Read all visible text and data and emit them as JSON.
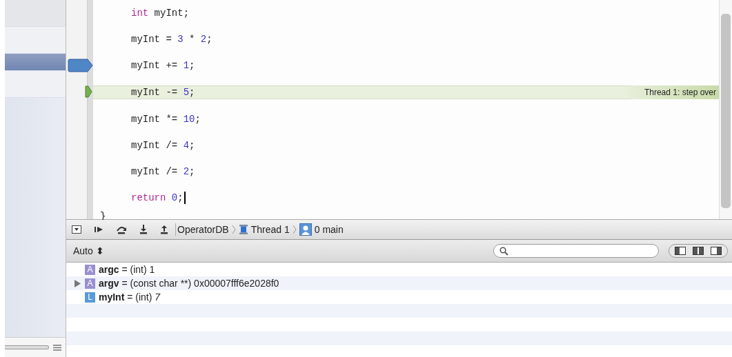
{
  "sidebar": {
    "rows": [
      {
        "selected": false
      },
      {
        "selected": false
      },
      {
        "selected": true
      },
      {
        "selected": false
      }
    ]
  },
  "code": {
    "lines": [
      {
        "tokens": [
          {
            "text": "int",
            "kind": "keyword"
          },
          {
            "text": " myInt;",
            "kind": "plain"
          }
        ],
        "breakpoint": false,
        "current": false
      },
      {
        "tokens": [
          {
            "text": "myInt = ",
            "kind": "plain"
          },
          {
            "text": "3",
            "kind": "number"
          },
          {
            "text": " * ",
            "kind": "plain"
          },
          {
            "text": "2",
            "kind": "number"
          },
          {
            "text": ";",
            "kind": "plain"
          }
        ],
        "breakpoint": false,
        "current": false
      },
      {
        "tokens": [
          {
            "text": "myInt += ",
            "kind": "plain"
          },
          {
            "text": "1",
            "kind": "number"
          },
          {
            "text": ";",
            "kind": "plain"
          }
        ],
        "breakpoint": true,
        "current": false
      },
      {
        "tokens": [
          {
            "text": "myInt -= ",
            "kind": "plain"
          },
          {
            "text": "5",
            "kind": "number"
          },
          {
            "text": ";",
            "kind": "plain"
          }
        ],
        "breakpoint": false,
        "current": true,
        "annotation": "Thread 1: step over"
      },
      {
        "tokens": [
          {
            "text": "myInt *= ",
            "kind": "plain"
          },
          {
            "text": "10",
            "kind": "number"
          },
          {
            "text": ";",
            "kind": "plain"
          }
        ],
        "breakpoint": false,
        "current": false
      },
      {
        "tokens": [
          {
            "text": "myInt /= ",
            "kind": "plain"
          },
          {
            "text": "4",
            "kind": "number"
          },
          {
            "text": ";",
            "kind": "plain"
          }
        ],
        "breakpoint": false,
        "current": false
      },
      {
        "tokens": [
          {
            "text": "myInt /= ",
            "kind": "plain"
          },
          {
            "text": "2",
            "kind": "number"
          },
          {
            "text": ";",
            "kind": "plain"
          }
        ],
        "breakpoint": false,
        "current": false
      },
      {
        "tokens": [
          {
            "text": "return",
            "kind": "keyword"
          },
          {
            "text": " 0",
            "kind": "number"
          },
          {
            "text": ";",
            "kind": "plain"
          }
        ],
        "breakpoint": false,
        "current": false,
        "cursor": true
      }
    ],
    "closing": "}"
  },
  "debug_bar": {
    "breadcrumbs": [
      {
        "label": "OperatorDB",
        "kind": "project"
      },
      {
        "label": "Thread 1",
        "kind": "thread"
      },
      {
        "label": "0 main",
        "kind": "frame"
      }
    ]
  },
  "variables": {
    "scope": "Auto",
    "scope_arrows": "⬍",
    "rows": [
      {
        "badge": "A",
        "kind": "argument",
        "text": "**argc** = (int) 1",
        "expandable": false
      },
      {
        "badge": "A",
        "kind": "argument",
        "text": "**argv** = (const char **) 0x00007fff6e2028f0",
        "expandable": true
      },
      {
        "badge": "L",
        "kind": "local",
        "text": "**myInt** = (int) *7*",
        "expandable": false
      }
    ]
  }
}
